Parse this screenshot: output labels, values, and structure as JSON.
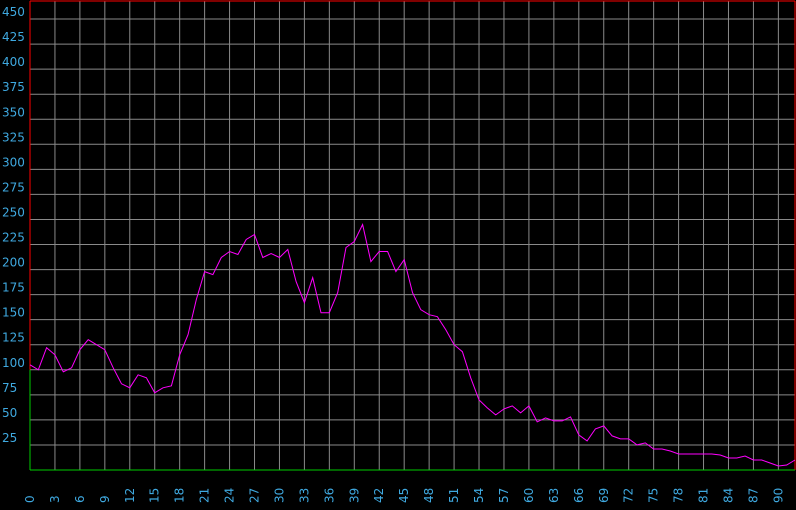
{
  "chart_data": {
    "type": "line",
    "title": "",
    "xlabel": "",
    "ylabel": "",
    "xlim": [
      0,
      92
    ],
    "ylim": [
      0,
      468
    ],
    "grid": true,
    "y_ticks": [
      25,
      50,
      75,
      100,
      125,
      150,
      175,
      200,
      225,
      250,
      275,
      300,
      325,
      350,
      375,
      400,
      425,
      450
    ],
    "x_ticks": [
      0,
      3,
      6,
      9,
      12,
      15,
      18,
      21,
      24,
      27,
      30,
      33,
      36,
      39,
      42,
      45,
      48,
      51,
      54,
      57,
      60,
      63,
      66,
      69,
      72,
      75,
      78,
      81,
      84,
      87,
      90
    ],
    "series": [
      {
        "color": "#ff00ff",
        "x": [
          0,
          1,
          2,
          3,
          4,
          5,
          6,
          7,
          8,
          9,
          10,
          11,
          12,
          13,
          14,
          15,
          16,
          17,
          18,
          19,
          20,
          21,
          22,
          23,
          24,
          25,
          26,
          27,
          28,
          29,
          30,
          31,
          32,
          33,
          34,
          35,
          36,
          37,
          38,
          39,
          40,
          41,
          42,
          43,
          44,
          45,
          46,
          47,
          48,
          49,
          50,
          51,
          52,
          53,
          54,
          55,
          56,
          57,
          58,
          59,
          60,
          61,
          62,
          63,
          64,
          65,
          66,
          67,
          68,
          69,
          70,
          71,
          72,
          73,
          74,
          75,
          76,
          77,
          78,
          79,
          80,
          81,
          82,
          83,
          84,
          85,
          86,
          87,
          88,
          89,
          90,
          91,
          92
        ],
        "y": [
          105,
          100,
          122,
          115,
          98,
          102,
          120,
          130,
          125,
          120,
          102,
          86,
          82,
          95,
          92,
          77,
          82,
          84,
          115,
          135,
          170,
          198,
          195,
          212,
          218,
          215,
          230,
          235,
          212,
          216,
          212,
          220,
          188,
          167,
          192,
          157,
          157,
          177,
          222,
          228,
          245,
          208,
          218,
          218,
          198,
          210,
          177,
          160,
          155,
          153,
          140,
          125,
          118,
          92,
          70,
          62,
          55,
          61,
          64,
          57,
          64,
          48,
          52,
          49,
          49,
          53,
          35,
          29,
          41,
          44,
          34,
          31,
          31,
          25,
          27,
          21,
          21,
          19,
          16,
          16,
          16,
          16,
          16,
          15,
          12,
          12,
          14,
          10,
          10,
          7,
          4,
          5,
          10
        ]
      }
    ]
  }
}
